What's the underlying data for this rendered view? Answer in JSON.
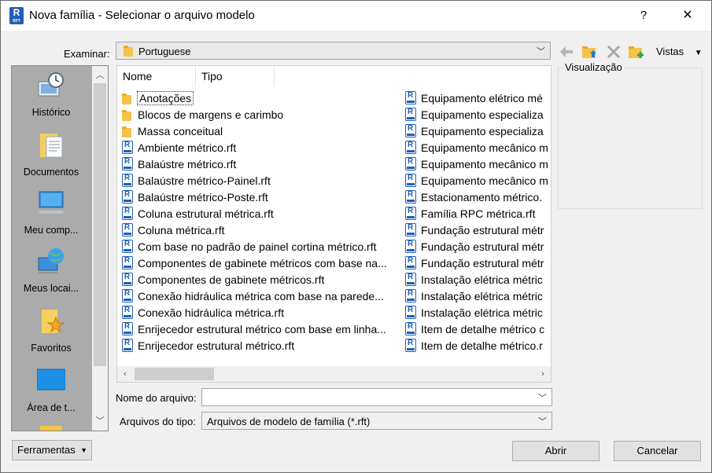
{
  "window": {
    "title": "Nova família - Selecionar o arquivo modelo",
    "help_label": "?",
    "close_label": "✕"
  },
  "lookin": {
    "label": "Examinar:",
    "value": "Portuguese"
  },
  "toolbar": {
    "views_label": "Vistas"
  },
  "places": {
    "items": [
      {
        "label": "Histórico",
        "icon": "history-icon"
      },
      {
        "label": "Documentos",
        "icon": "documents-icon"
      },
      {
        "label": "Meu comp...",
        "icon": "computer-icon"
      },
      {
        "label": "Meus locai...",
        "icon": "network-icon"
      },
      {
        "label": "Favoritos",
        "icon": "favorites-icon"
      },
      {
        "label": "Área de t...",
        "icon": "desktop-icon"
      }
    ]
  },
  "filelist": {
    "columns": [
      "Nome",
      "Tipo"
    ],
    "left_items": [
      {
        "name": "Anotações",
        "kind": "folder"
      },
      {
        "name": "Blocos de margens e carimbo",
        "kind": "folder"
      },
      {
        "name": "Massa conceitual",
        "kind": "folder"
      },
      {
        "name": "Ambiente métrico.rft",
        "kind": "rft"
      },
      {
        "name": "Balaústre métrico.rft",
        "kind": "rft"
      },
      {
        "name": "Balaústre métrico-Painel.rft",
        "kind": "rft"
      },
      {
        "name": "Balaústre métrico-Poste.rft",
        "kind": "rft"
      },
      {
        "name": "Coluna estrutural métrica.rft",
        "kind": "rft"
      },
      {
        "name": "Coluna métrica.rft",
        "kind": "rft"
      },
      {
        "name": "Com base no padrão de painel cortina métrico.rft",
        "kind": "rft"
      },
      {
        "name": "Componentes de gabinete métricos com base na...",
        "kind": "rft"
      },
      {
        "name": "Componentes de gabinete métricos.rft",
        "kind": "rft"
      },
      {
        "name": "Conexão hidráulica métrica com base na parede...",
        "kind": "rft"
      },
      {
        "name": "Conexão hidráulica métrica.rft",
        "kind": "rft"
      },
      {
        "name": "Enrijecedor estrutural métrico com base em linha...",
        "kind": "rft"
      },
      {
        "name": "Enrijecedor estrutural métrico.rft",
        "kind": "rft"
      }
    ],
    "right_items": [
      {
        "name": "Equipamento elétrico mé",
        "kind": "rft"
      },
      {
        "name": "Equipamento especializa",
        "kind": "rft"
      },
      {
        "name": "Equipamento especializa",
        "kind": "rft"
      },
      {
        "name": "Equipamento mecânico m",
        "kind": "rft"
      },
      {
        "name": "Equipamento mecânico m",
        "kind": "rft"
      },
      {
        "name": "Equipamento mecânico m",
        "kind": "rft"
      },
      {
        "name": "Estacionamento métrico.",
        "kind": "rft"
      },
      {
        "name": "Família RPC métrica.rft",
        "kind": "rft"
      },
      {
        "name": "Fundação estrutural métr",
        "kind": "rft"
      },
      {
        "name": "Fundação estrutural métr",
        "kind": "rft"
      },
      {
        "name": "Fundação estrutural métr",
        "kind": "rft"
      },
      {
        "name": "Instalação elétrica métric",
        "kind": "rft"
      },
      {
        "name": "Instalação elétrica métric",
        "kind": "rft"
      },
      {
        "name": "Instalação elétrica métric",
        "kind": "rft"
      },
      {
        "name": "Item de detalhe métrico c",
        "kind": "rft"
      },
      {
        "name": "Item de detalhe métrico.r",
        "kind": "rft"
      }
    ]
  },
  "preview": {
    "label": "Visualização"
  },
  "filename": {
    "label": "Nome do arquivo:",
    "value": ""
  },
  "filetype": {
    "label": "Arquivos do tipo:",
    "value": "Arquivos de modelo de família  (*.rft)"
  },
  "buttons": {
    "tools_label": "Ferramentas",
    "open_label": "Abrir",
    "cancel_label": "Cancelar"
  },
  "colors": {
    "accent": "#1f5fb4",
    "folder": "#f5c34a",
    "green_plus": "#2da44e"
  }
}
